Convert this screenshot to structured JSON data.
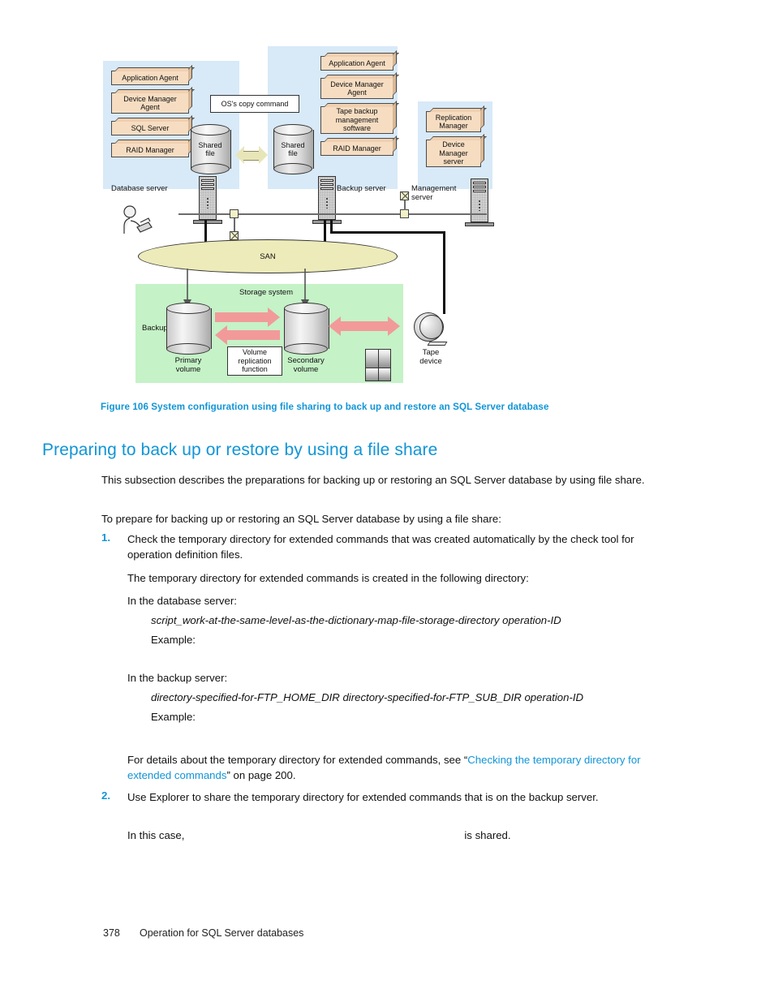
{
  "figure": {
    "database_server": {
      "label": "Database server",
      "components": [
        "Application Agent",
        "Device Manager\nAgent",
        "SQL Server",
        "RAID Manager"
      ],
      "shared_file": "Shared\nfile"
    },
    "backup_server": {
      "label": "Backup server",
      "components": [
        "Application Agent",
        "Device Manager\nAgent",
        "Tape backup\nmanagement\nsoftware",
        "RAID Manager"
      ],
      "shared_file": "Shared\nfile"
    },
    "management_server": {
      "label": "Management\nserver",
      "components": [
        "Replication\nManager",
        "Device\nManager\nserver"
      ]
    },
    "copy_command": "OS's copy command",
    "san": "SAN",
    "storage_system": "Storage system",
    "backup_data": "Backup data",
    "primary_volume": "Primary\nvolume",
    "secondary_volume": "Secondary\nvolume",
    "volume_replication": "Volume\nreplication\nfunction",
    "tape_device": "Tape\ndevice",
    "colors": {
      "panel_blue": "#d8e9f8",
      "box_tan": "#f6ddc2",
      "san_yellow": "#ecebb9",
      "storage_green": "#c5f2c7",
      "arrow_pink": "#f29a9a",
      "accent_blue": "#1195d6"
    }
  },
  "caption": "Figure 106 System configuration using file sharing to back up and restore an SQL Server database",
  "heading": "Preparing to back up or restore by using a file share",
  "paragraphs": {
    "intro": "This subsection describes the preparations for backing up or restoring an SQL Server database by using file share.",
    "prepare": "To prepare for backing up or restoring an SQL Server database by using a file share:",
    "step1_num": "1.",
    "step1": "Check the temporary directory for extended commands that was created automatically by the check tool for operation definition files.",
    "step1_sub1": "The temporary directory for extended commands is created in the following directory:",
    "db_server_label": "In the database server:",
    "db_server_path": "script_work-at-the-same-level-as-the-dictionary-map-file-storage-directory  operation-ID",
    "db_example": "Example:",
    "backup_server_label": "In the backup server:",
    "backup_server_path": "directory-specified-for-FTP_HOME_DIR  directory-specified-for-FTP_SUB_DIR  operation-ID",
    "backup_example": "Example:",
    "details_pre": "For details about the temporary directory for extended commands, see “",
    "details_link": "Checking the temporary directory for extended commands",
    "details_post": "” on page 200.",
    "step2_num": "2.",
    "step2": "Use Explorer to share the temporary directory for extended commands that is on the backup server.",
    "step2_sub_pre": "In this case,",
    "step2_sub_post": "is shared."
  },
  "footer": {
    "page_number": "378",
    "chapter": "Operation for SQL Server databases"
  }
}
